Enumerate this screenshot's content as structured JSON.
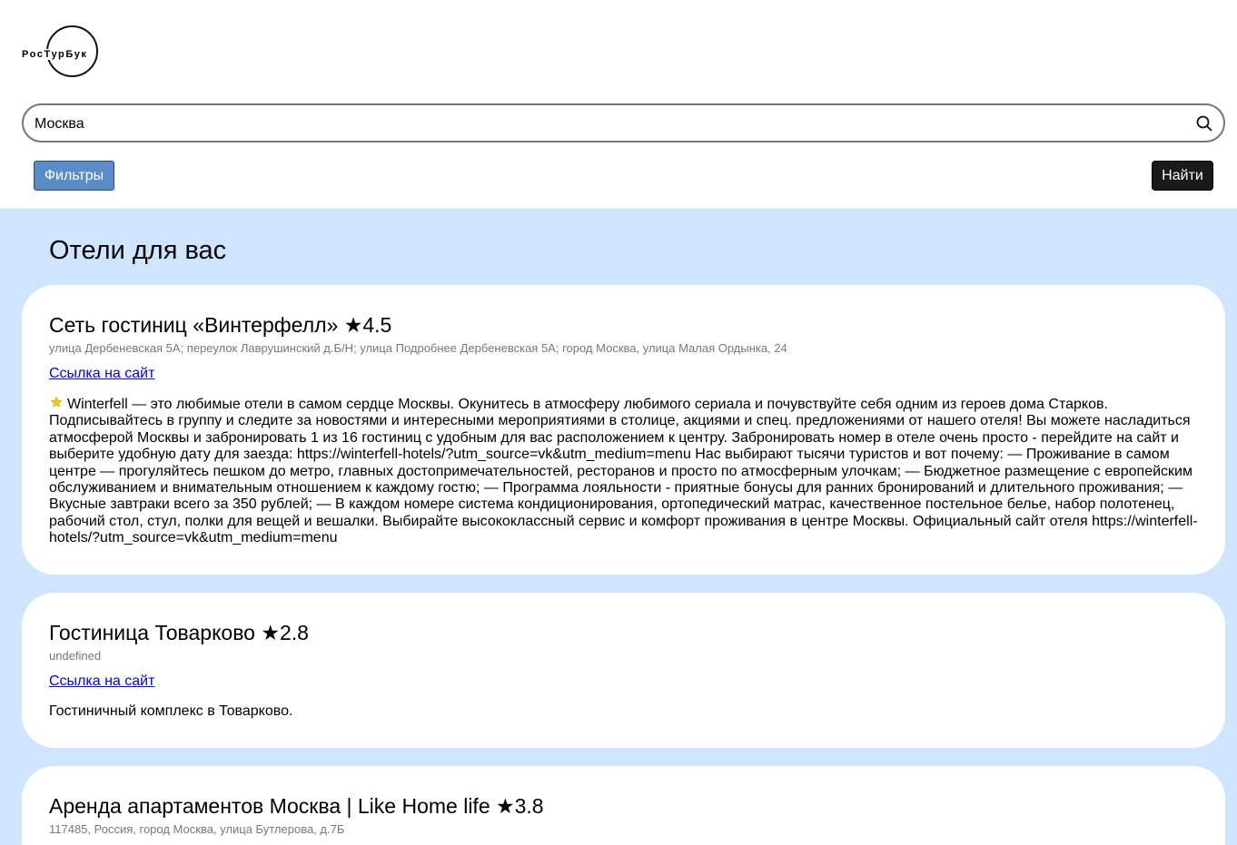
{
  "logo": {
    "text": "РосТурБук"
  },
  "search": {
    "value": "Москва"
  },
  "buttons": {
    "filters": "Фильтры",
    "find": "Найти"
  },
  "section_title": "Отели для вас",
  "hotels": [
    {
      "name": "Сеть гостиниц «Винтерфелл» ★4.5",
      "address": "улица Дербеневская 5А; переулок Лаврушинский д.Б/Н; улица Подробнее Дербеневская 5А; город Москва, улица Малая Ордынка, 24",
      "link": "Ссылка на сайт",
      "description": "Winterfell — это любимые отели в самом сердце Москвы. Окунитесь в атмосферу любимого сериала и почувствуйте себя одним из героев дома Старков. Подписывайтесь в группу и следите за новостями и интересными мероприятиями в столице, акциями и спец. предложениями от нашего отеля! Вы можете насладиться атмосферой Москвы и забронировать 1 из 16 гостиниц с удобным для вас расположением к центру. Забронировать номер в отеле очень просто - перейдите на сайт и выберите удобную дату для заезда: https://winterfell-hotels/?utm_source=vk&utm_medium=menu Нас выбирают тысячи туристов и вот почему: — Проживание в самом центре — прогуляйтесь пешком до метро, главных достопримечательностей, ресторанов и просто по атмосферным улочкам; — Бюджетное размещение с европейским обслуживанием и внимательным отношением к каждому гостю; — Программа лояльности - приятные бонусы для ранних бронирований и длительного проживания; — Вкусные завтраки всего за 350 рублей; — В каждом номере система кондиционирования, ортопедический матрас, качественное постельное белье, набор полотенец, рабочий стол, стул, полки для вещей и вешалки. Выбирайте высококлассный сервис и комфорт проживания в центре Москвы. Официальный сайт отеля https://winterfell-hotels/?utm_source=vk&utm_medium=menu",
      "star_color": "#f5c518"
    },
    {
      "name": "Гостиница Товарково ★2.8",
      "address": "undefined",
      "link": "Ссылка на сайт",
      "description": "Гостиничный комплекс в Товарково."
    },
    {
      "name": "Аренда апартаментов Москва | Like Home life ★3.8",
      "address": "117485, Россия, город Москва, улица Бутлерова, д.7Б"
    }
  ],
  "colors": {
    "page_bg": "#cfe5ff",
    "filters_button": "#5a8cc8",
    "find_button": "#1a1a1a",
    "link": "#0000ee"
  },
  "icons": {
    "search": "search-icon",
    "desc_star": "star-icon"
  }
}
